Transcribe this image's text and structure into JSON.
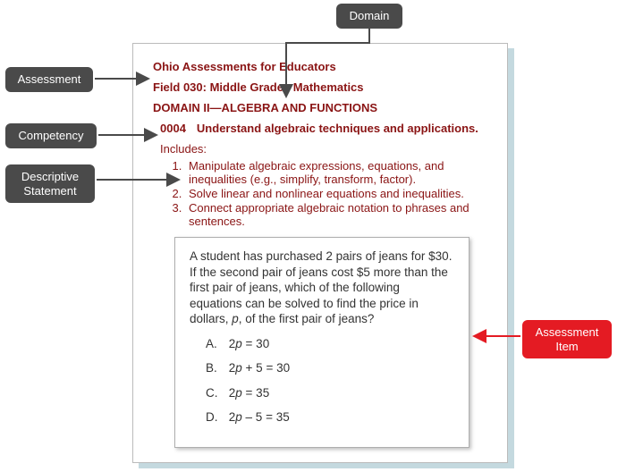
{
  "labels": {
    "domain": "Domain",
    "assessment": "Assessment",
    "competency": "Competency",
    "descriptive_statement": "Descriptive\nStatement",
    "assessment_item": "Assessment\nItem"
  },
  "page": {
    "assessment_title": "Ohio Assessments for Educators",
    "field_line": "Field 030: Middle Grades Mathematics",
    "domain_line": "DOMAIN II—ALGEBRA AND FUNCTIONS",
    "competency": {
      "code": "0004",
      "text": "Understand algebraic techniques and applications."
    },
    "includes_label": "Includes:",
    "includes": [
      "Manipulate algebraic expressions, equations, and inequalities (e.g., simplify, transform, factor).",
      "Solve linear and nonlinear equations and inequalities.",
      "Connect appropriate algebraic notation to phrases and sentences."
    ],
    "item": {
      "stem_pre": "A student has purchased 2 pairs of jeans for $30. If the second pair of jeans cost $5 more than the first pair of jeans, which of the following equations can be solved to find the price in dollars, ",
      "stem_var": "p",
      "stem_post": ", of the first pair of jeans?",
      "choices": {
        "A": {
          "pre": "2",
          "var": "p",
          "post": " = 30"
        },
        "B": {
          "pre": "2",
          "var": "p",
          "post": " + 5 = 30"
        },
        "C": {
          "pre": "2",
          "var": "p",
          "post": " = 35"
        },
        "D": {
          "pre": "2",
          "var": "p",
          "post": " – 5 = 35"
        }
      }
    }
  }
}
